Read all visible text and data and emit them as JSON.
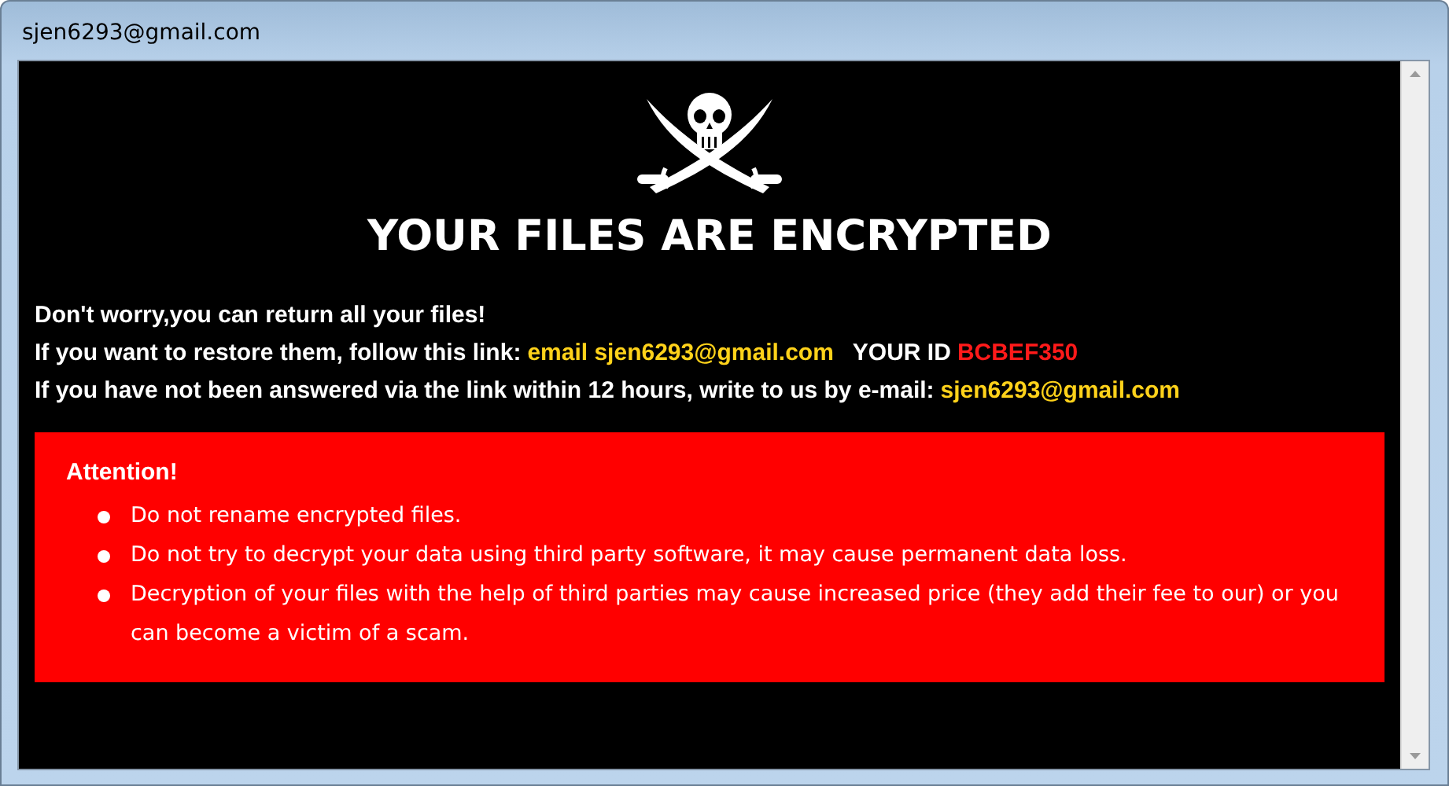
{
  "window": {
    "title": "sjen6293@gmail.com"
  },
  "note": {
    "heading": "YOUR FILES ARE ENCRYPTED",
    "lines": [
      [
        {
          "kind": "plain",
          "text": "Don't worry,you can return all your files!"
        }
      ],
      [
        {
          "kind": "plain",
          "text": "If you want to restore them, follow this link:"
        },
        {
          "kind": "link",
          "text": "email sjen6293@gmail.com"
        },
        {
          "kind": "plain",
          "text": "YOUR ID"
        },
        {
          "kind": "id",
          "text": "BCBEF350"
        }
      ],
      [
        {
          "kind": "plain",
          "text": "If you have not been answered via the link within 12 hours, write to us by e-mail:"
        },
        {
          "kind": "link",
          "text": "sjen6293@gmail.com"
        }
      ]
    ],
    "attention": {
      "title": "Attention!",
      "items": [
        "Do not rename encrypted files.",
        "Do not try to decrypt your data using third party software, it may cause permanent data loss.",
        "Decryption of your files with the help of third parties may cause increased price (they add their fee to our) or you can become a victim of a scam."
      ]
    }
  }
}
